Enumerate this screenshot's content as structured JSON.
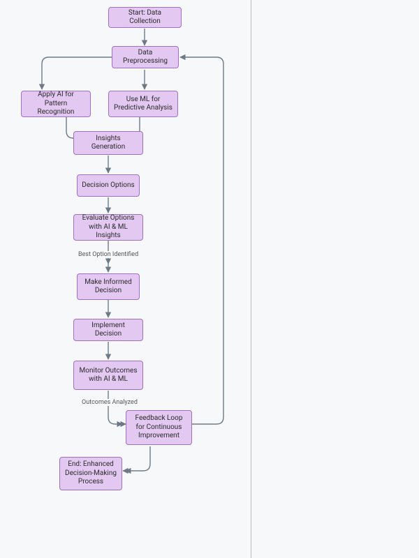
{
  "diagram": {
    "type": "flowchart",
    "nodes": {
      "start": {
        "label": "Start: Data Collection"
      },
      "preprocess": {
        "label": "Data Preprocessing"
      },
      "ai_pattern": {
        "label": "Apply AI for Pattern Recognition"
      },
      "ml_predict": {
        "label": "Use ML for Predictive Analysis"
      },
      "insights": {
        "label": "Insights Generation"
      },
      "options": {
        "label": "Decision Options"
      },
      "evaluate": {
        "label": "Evaluate Options with AI & ML Insights"
      },
      "make": {
        "label": "Make Informed Decision"
      },
      "implement": {
        "label": "Implement Decision"
      },
      "monitor": {
        "label": "Monitor Outcomes with AI & ML"
      },
      "feedback": {
        "label": "Feedback Loop for Continuous Improvement"
      },
      "end": {
        "label": "End: Enhanced Decision-Making Process"
      }
    },
    "edge_labels": {
      "best_option": "Best Option Identified",
      "outcomes": "Outcomes Analyzed"
    },
    "colors": {
      "node_fill": "#e3c8f2",
      "node_border": "#a070c0",
      "arrow": "#6d7a86",
      "background": "#f7f8fa"
    }
  }
}
